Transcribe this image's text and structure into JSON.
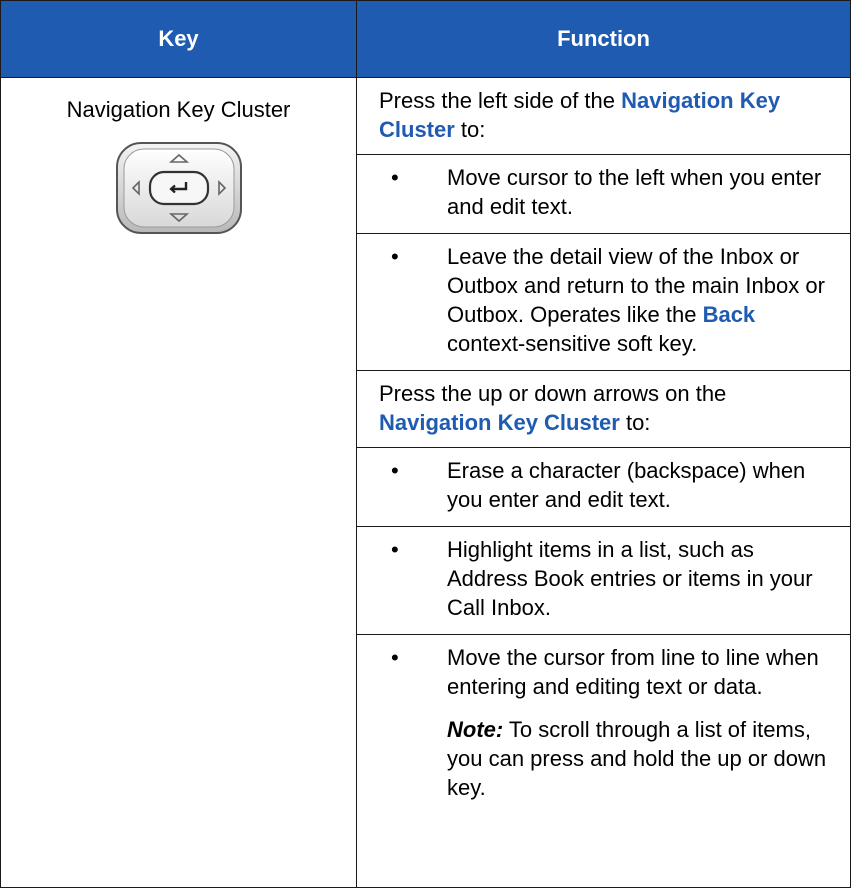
{
  "header": {
    "key": "Key",
    "function": "Function"
  },
  "key_cell": {
    "label": "Navigation Key Cluster",
    "icon": "navigation-key-cluster-icon"
  },
  "colors": {
    "header_bg": "#1f5bb0",
    "link": "#1f5bb0"
  },
  "function": {
    "intro1": {
      "pre": "Press the left side of the ",
      "highlight": "Navigation Key Cluster",
      "post": " to:"
    },
    "bullet1": "Move cursor to the left when you enter and edit text.",
    "bullet2": {
      "pre": "Leave the detail view of the Inbox or Outbox and return to the main Inbox or Outbox. Operates like the ",
      "highlight": "Back",
      "post": " context-sensitive soft key."
    },
    "intro2": {
      "pre": "Press the up or down arrows on the ",
      "highlight": "Navigation Key Cluster",
      "post": " to:"
    },
    "bullet3": "Erase a character (backspace) when you enter and edit text.",
    "bullet4": "Highlight items in a list, such as Address Book entries or items in your Call Inbox.",
    "bullet5": "Move the cursor from line to line when entering and editing text or data.",
    "note": {
      "label": "Note:",
      "text": "  To scroll through a list of items, you can press and hold the up or down key."
    }
  }
}
